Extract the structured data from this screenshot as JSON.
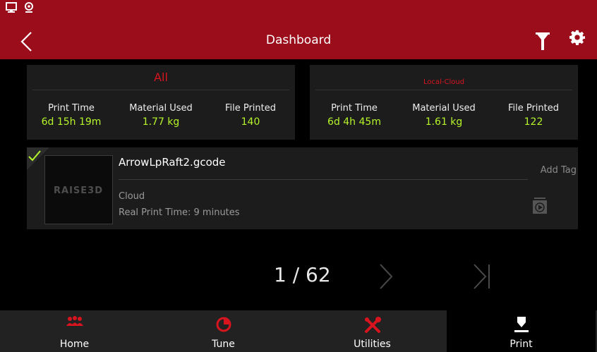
{
  "header": {
    "title": "Dashboard"
  },
  "stats": [
    {
      "title": "All",
      "items": [
        {
          "label": "Print Time",
          "value": "6d 15h 19m"
        },
        {
          "label": "Material Used",
          "value": "1.77 kg"
        },
        {
          "label": "File Printed",
          "value": "140"
        }
      ]
    },
    {
      "title": "Local-Cloud",
      "items": [
        {
          "label": "Print Time",
          "value": "6d 4h 45m"
        },
        {
          "label": "Material Used",
          "value": "1.61 kg"
        },
        {
          "label": "File Printed",
          "value": "122"
        }
      ]
    }
  ],
  "file": {
    "name": "ArrowLpRaft2.gcode",
    "source": "Cloud",
    "real_print_time": "Real Print Time: 9 minutes",
    "add_tag": "Add Tag",
    "thumb_logo": "RAISE3D"
  },
  "pagination": {
    "text": "1 / 62"
  },
  "tabs": [
    {
      "label": "Home",
      "icon": "users-icon"
    },
    {
      "label": "Tune",
      "icon": "pie-chart-icon"
    },
    {
      "label": "Utilities",
      "icon": "tools-icon"
    },
    {
      "label": "Print",
      "icon": "print-icon"
    }
  ],
  "colors": {
    "accent": "#9b0d1a",
    "value_green": "#b5f52a",
    "active_red": "#d8141f"
  }
}
